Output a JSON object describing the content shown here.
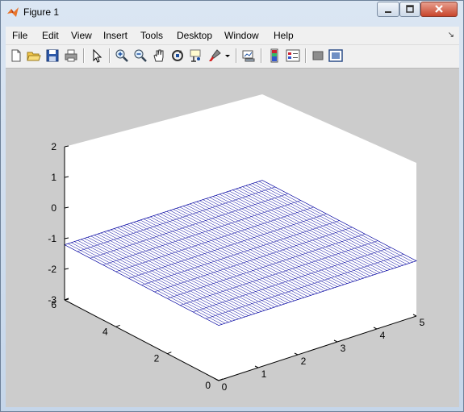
{
  "window": {
    "title": "Figure 1"
  },
  "menu": {
    "items": [
      "File",
      "Edit",
      "View",
      "Insert",
      "Tools",
      "Desktop",
      "Window",
      "Help"
    ]
  },
  "toolbar": {
    "icons": [
      "new-figure-icon",
      "open-file-icon",
      "save-icon",
      "print-icon",
      "select-arrow-icon",
      "zoom-in-icon",
      "zoom-out-icon",
      "pan-hand-icon",
      "rotate-3d-icon",
      "data-cursor-icon",
      "brush-icon",
      "brush-dropdown-icon",
      "link-plot-icon",
      "colorbar-icon",
      "legend-icon",
      "hide-plot-tools-icon",
      "show-plot-tools-icon"
    ]
  },
  "chart_data": {
    "type": "surface",
    "title": "",
    "xlabel": "",
    "ylabel": "",
    "zlabel": "",
    "xlim": [
      0,
      5
    ],
    "ylim": [
      0,
      6
    ],
    "zlim": [
      -3,
      2
    ],
    "x_ticks": [
      "0",
      "1",
      "2",
      "3",
      "4",
      "5"
    ],
    "y_ticks": [
      "0",
      "2",
      "4",
      "6"
    ],
    "z_ticks": [
      "2",
      "1",
      "0",
      "-1",
      "-2",
      "-3"
    ],
    "surface": {
      "description_value": "flat plane",
      "z": -1.2,
      "mesh_color": "#0000a0",
      "face_color": "#ffffff"
    },
    "grid": false,
    "background_color": "#ffffff",
    "figure_color": "#cccccc"
  }
}
